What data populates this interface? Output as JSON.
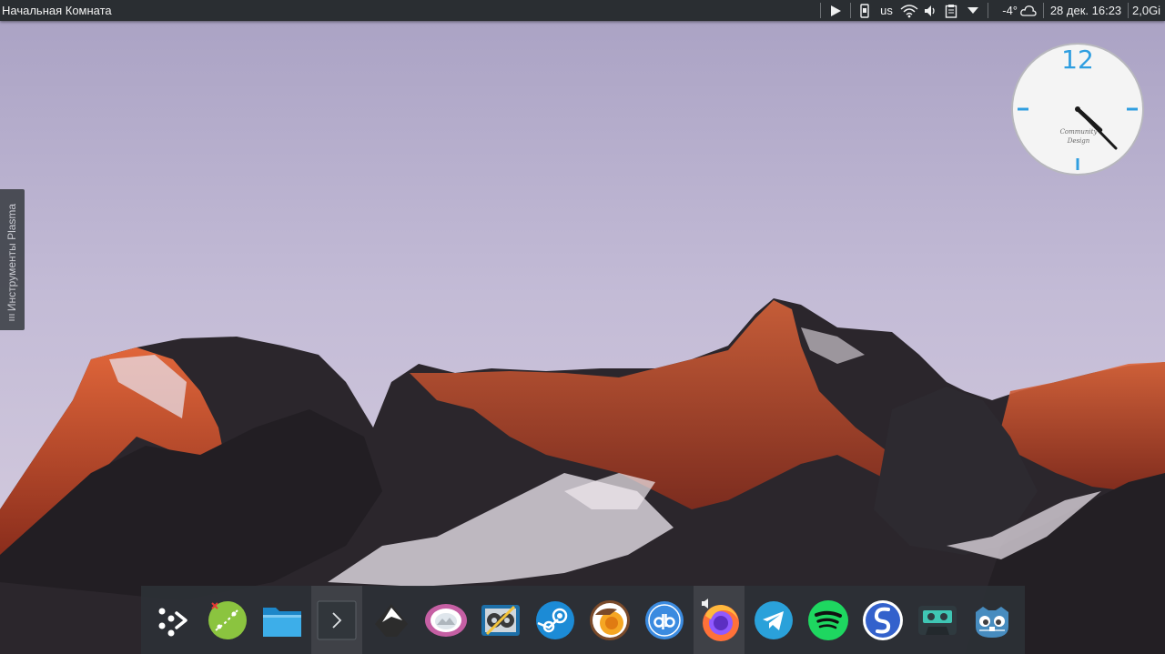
{
  "window": {
    "title": "Начальная Комната"
  },
  "tray": {
    "keyboard_layout": "us",
    "temperature": "-4°",
    "datetime": "28 дек. 16:23",
    "memory": "2,0Gi"
  },
  "plasma_tab": {
    "label": "Инструменты Plasma"
  },
  "clock": {
    "twelve": "12",
    "brand_line1": "Community",
    "brand_line2": "Design",
    "time_shown": "16:23"
  },
  "dock": {
    "items": [
      {
        "name": "application-launcher",
        "icon": "kde-launcher-icon"
      },
      {
        "name": "kstars",
        "icon": "kstars-icon"
      },
      {
        "name": "dolphin",
        "icon": "folder-icon"
      },
      {
        "name": "konsole",
        "icon": "terminal-icon",
        "active": true
      },
      {
        "name": "inkscape",
        "icon": "inkscape-icon"
      },
      {
        "name": "gwenview",
        "icon": "image-viewer-icon"
      },
      {
        "name": "kdenlive",
        "icon": "video-editor-icon"
      },
      {
        "name": "steam",
        "icon": "steam-icon"
      },
      {
        "name": "blender",
        "icon": "blender-icon"
      },
      {
        "name": "qbittorrent",
        "icon": "qbittorrent-icon"
      },
      {
        "name": "firefox",
        "icon": "firefox-icon",
        "active": true
      },
      {
        "name": "telegram",
        "icon": "telegram-icon"
      },
      {
        "name": "spotify",
        "icon": "spotify-icon"
      },
      {
        "name": "simplenote",
        "icon": "simplenote-icon"
      },
      {
        "name": "cassette-player",
        "icon": "cassette-icon"
      },
      {
        "name": "godot",
        "icon": "godot-icon"
      }
    ]
  },
  "colors": {
    "panel": "#2a2e32",
    "dock": "#2c3036",
    "accent": "#2f9ee0"
  }
}
